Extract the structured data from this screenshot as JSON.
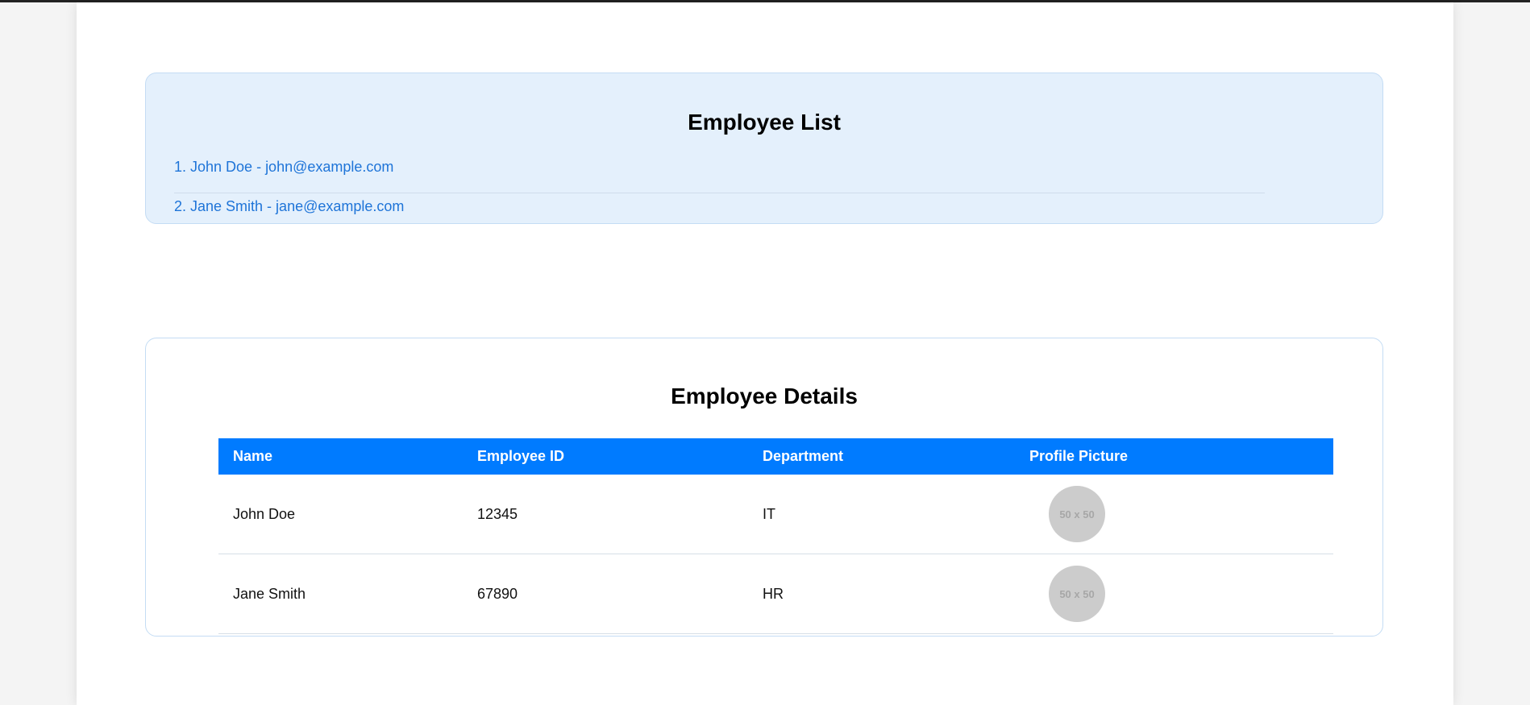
{
  "employee_list": {
    "title": "Employee List",
    "items": [
      "1. John Doe - john@example.com",
      "2. Jane Smith - jane@example.com"
    ]
  },
  "employee_details": {
    "title": "Employee Details",
    "columns": [
      "Name",
      "Employee ID",
      "Department",
      "Profile Picture"
    ],
    "rows": [
      {
        "name": "John Doe",
        "id": "12345",
        "department": "IT",
        "picture": "50 x 50"
      },
      {
        "name": "Jane Smith",
        "id": "67890",
        "department": "HR",
        "picture": "50 x 50"
      }
    ]
  },
  "colors": {
    "header_blue": "#007bff",
    "link_blue": "#1e74d8",
    "list_card_bg": "#e4f0fc"
  }
}
